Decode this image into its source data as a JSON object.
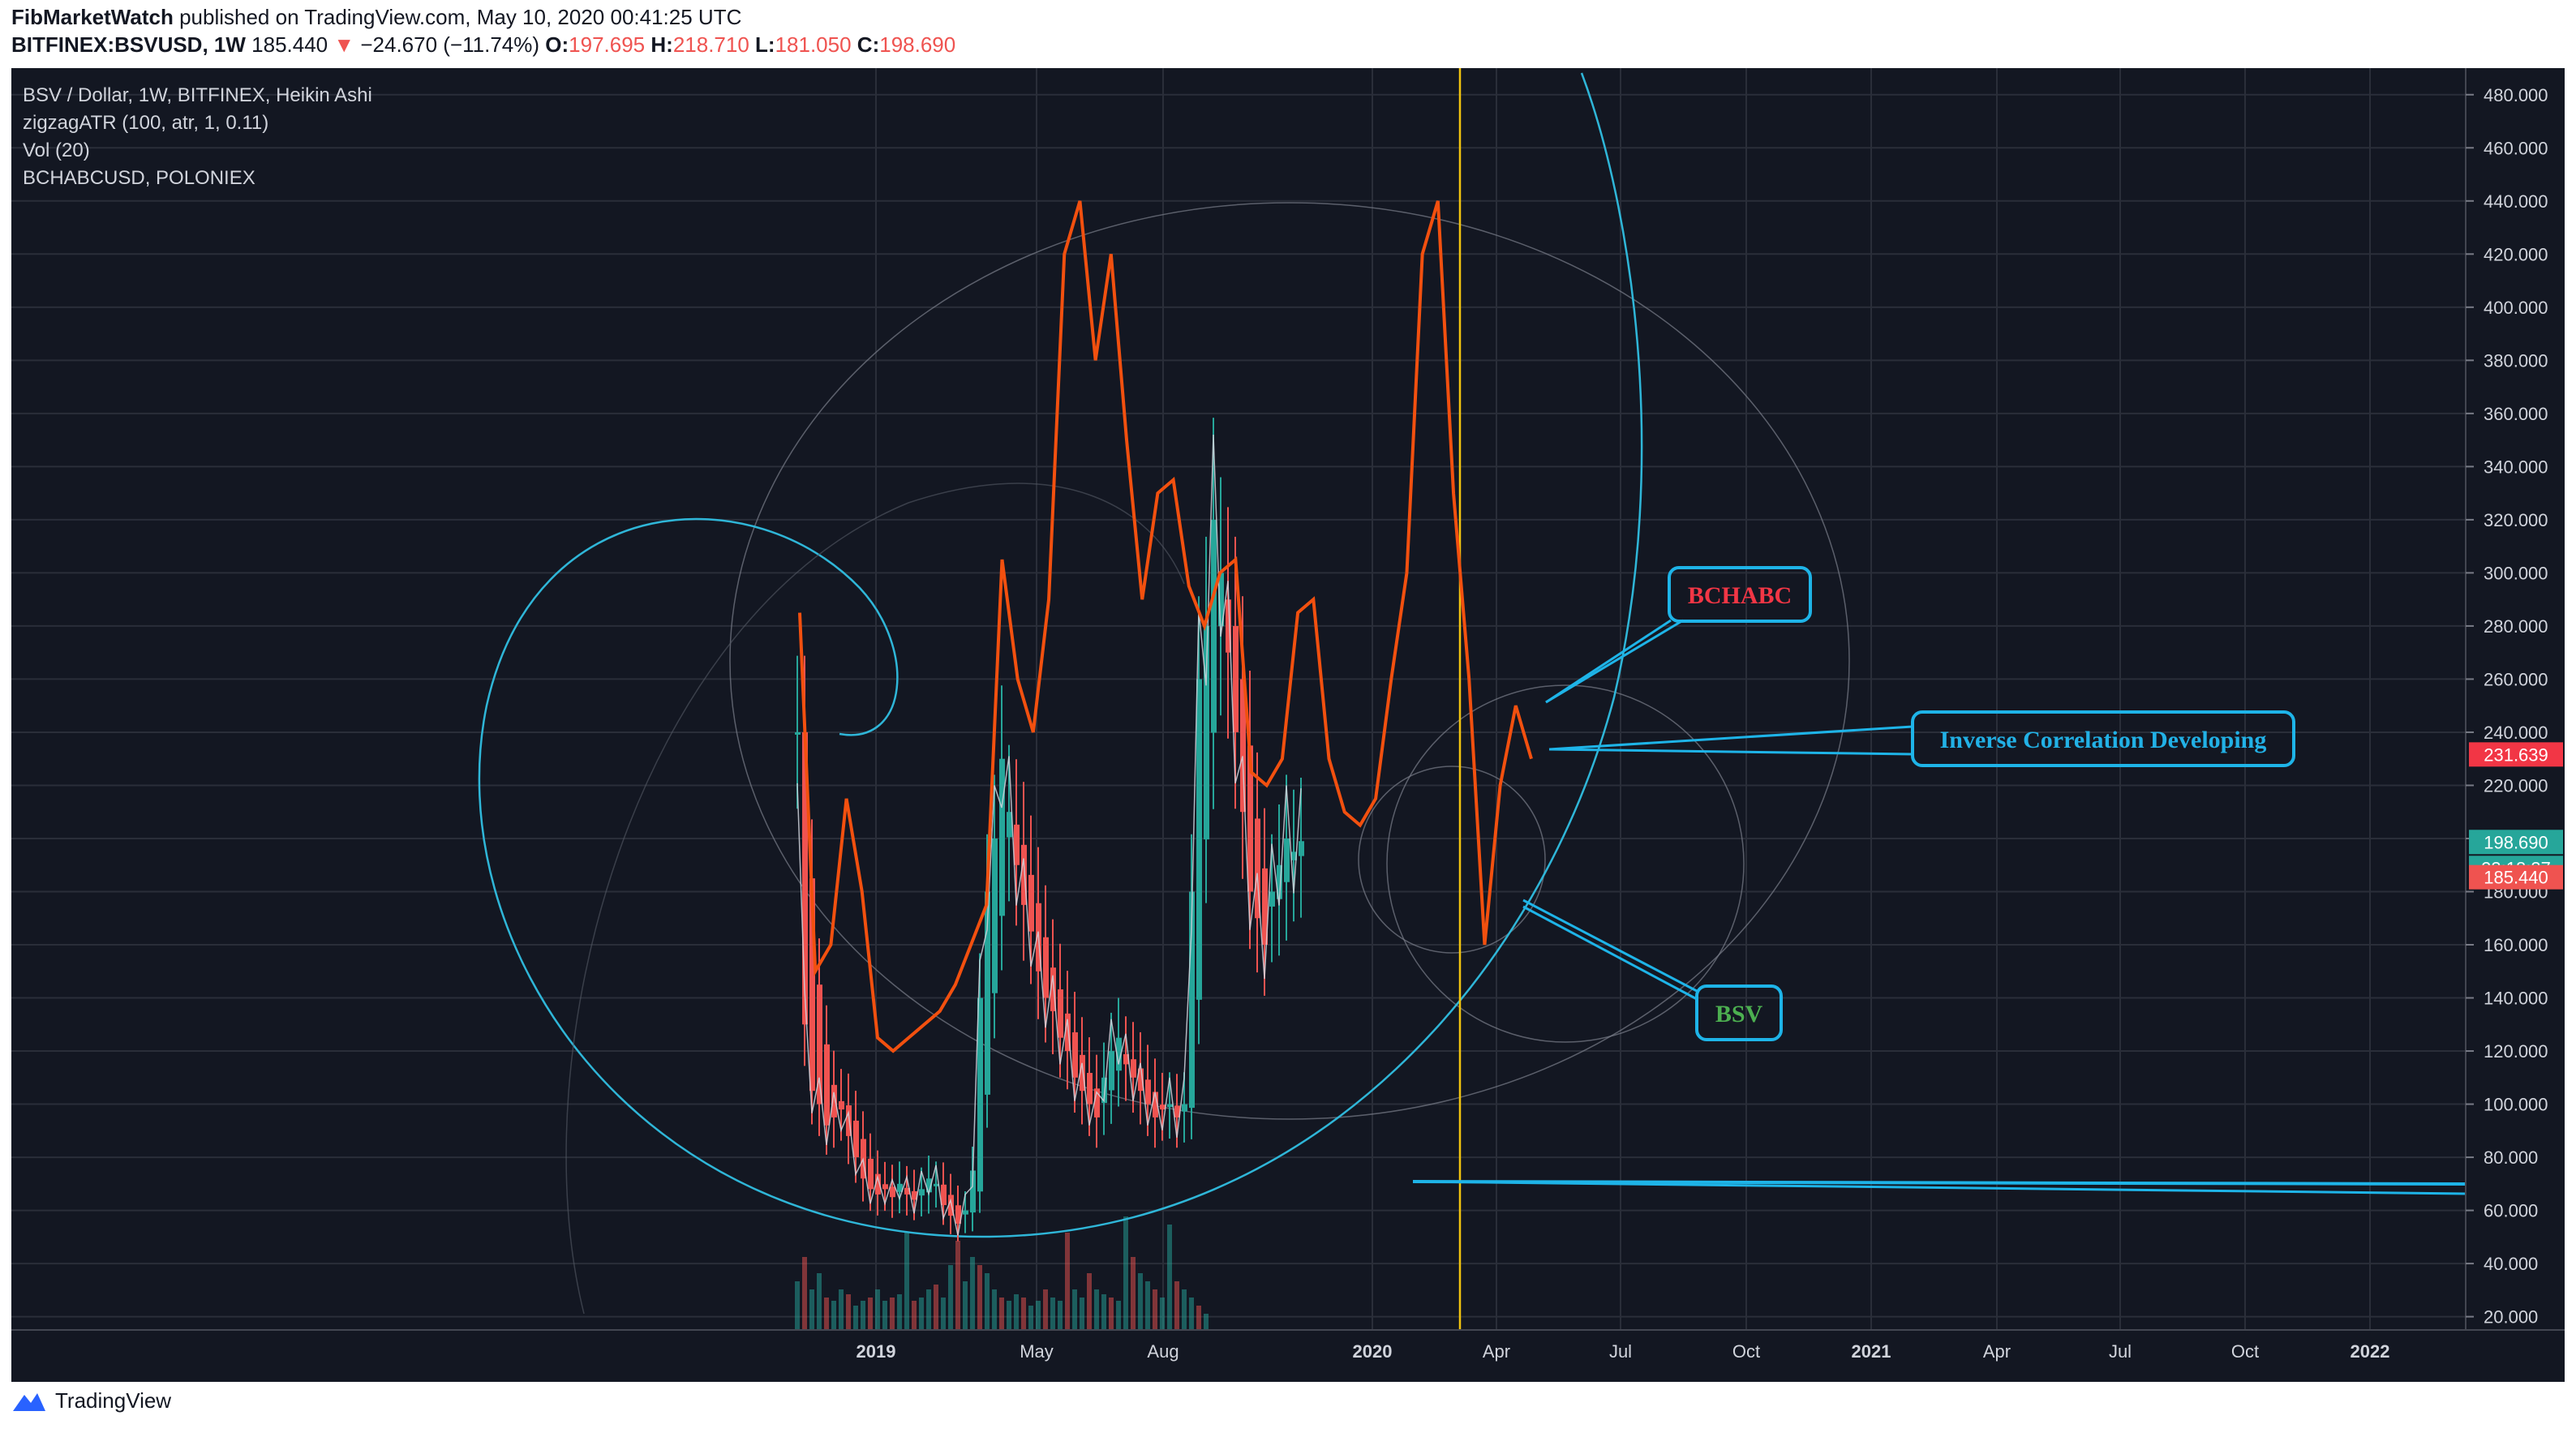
{
  "header": {
    "author": "FibMarketWatch",
    "published_text": "published on TradingView.com, May 10, 2020 00:41:25 UTC",
    "symbol": "BITFINEX:BSVUSD, 1W",
    "last_price": "185.440",
    "change_arrow": "▼",
    "change": "−24.670 (−11.74%)",
    "o_label": "O:",
    "o_val": "197.695",
    "h_label": "H:",
    "h_val": "218.710",
    "l_label": "L:",
    "l_val": "181.050",
    "c_label": "C:",
    "c_val": "198.690"
  },
  "legend": {
    "line1": "BSV / Dollar, 1W, BITFINEX, Heikin Ashi",
    "line2": "zigzagATR (100, atr, 1, 0.11)",
    "line3": "Vol (20)",
    "line4": "BCHABCUSD, POLONIEX"
  },
  "footer": {
    "brand": "TradingView",
    "logo_icon": "tradingview-logo-icon"
  },
  "colors": {
    "background": "#131722",
    "grid": "#2a2e39",
    "up_candle": "#26a69a",
    "down_candle": "#ef5350",
    "bchabc_line": "#f2500f",
    "zigzag": "#d1d4dc",
    "annotation": "#1eb4e8",
    "fib_spiral": "#2fb6d8",
    "vertical_line": "#f2c40f"
  },
  "annotations": {
    "bchabc": "BCHABC",
    "inverse": "Inverse Correlation Developing",
    "bsv": "BSV"
  },
  "price_tags": {
    "bchabc": "231.639",
    "close": "198.690",
    "countdown": "23:18:37",
    "last": "185.440"
  },
  "chart_data": {
    "type": "candlestick",
    "title": "BSV / Dollar, 1W, BITFINEX, Heikin Ashi",
    "price_axis": {
      "ylim": [
        15,
        490
      ],
      "ticks": [
        "480.000",
        "460.000",
        "440.000",
        "420.000",
        "400.000",
        "380.000",
        "360.000",
        "340.000",
        "320.000",
        "300.000",
        "280.000",
        "260.000",
        "240.000",
        "220.000",
        "200.000",
        "180.000",
        "160.000",
        "140.000",
        "120.000",
        "100.000",
        "80.000",
        "60.000",
        "40.000",
        "20.000"
      ]
    },
    "time_axis": {
      "ticks": [
        "2019",
        "May",
        "Aug",
        "2020",
        "Apr",
        "Jul",
        "Oct",
        "2021",
        "Apr",
        "Jul",
        "Oct",
        "2022"
      ]
    },
    "bsv_close_approx": [
      240,
      130,
      105,
      100,
      92,
      95,
      98,
      88,
      80,
      72,
      68,
      66,
      68,
      65,
      70,
      66,
      64,
      68,
      72,
      70,
      62,
      58,
      55,
      60,
      75,
      140,
      180,
      200,
      230,
      210,
      190,
      175,
      165,
      150,
      140,
      135,
      125,
      120,
      110,
      105,
      100,
      95,
      110,
      120,
      125,
      115,
      110,
      105,
      100,
      95,
      98,
      100,
      95,
      100,
      180,
      260,
      280,
      320,
      300,
      270,
      240,
      210,
      180,
      170,
      160,
      180,
      190,
      200,
      195,
      199
    ],
    "bchabc_line_approx": [
      285,
      150,
      160,
      215,
      180,
      125,
      120,
      125,
      130,
      135,
      145,
      160,
      175,
      305,
      260,
      240,
      290,
      420,
      440,
      380,
      420,
      350,
      290,
      330,
      335,
      295,
      280,
      300,
      305,
      225,
      220,
      230,
      285,
      290,
      230,
      210,
      205,
      215,
      260,
      300,
      420,
      440,
      330,
      260,
      160,
      220,
      250,
      230
    ],
    "volume_approx": [
      30,
      45,
      25,
      35,
      20,
      18,
      25,
      22,
      15,
      18,
      20,
      25,
      18,
      20,
      22,
      60,
      18,
      20,
      25,
      28,
      20,
      40,
      55,
      30,
      45,
      40,
      35,
      25,
      20,
      18,
      22,
      20,
      15,
      18,
      25,
      20,
      18,
      60,
      25,
      20,
      35,
      25,
      22,
      20,
      18,
      70,
      45,
      35,
      30,
      25,
      20,
      65,
      30,
      25,
      20,
      15,
      10
    ]
  }
}
